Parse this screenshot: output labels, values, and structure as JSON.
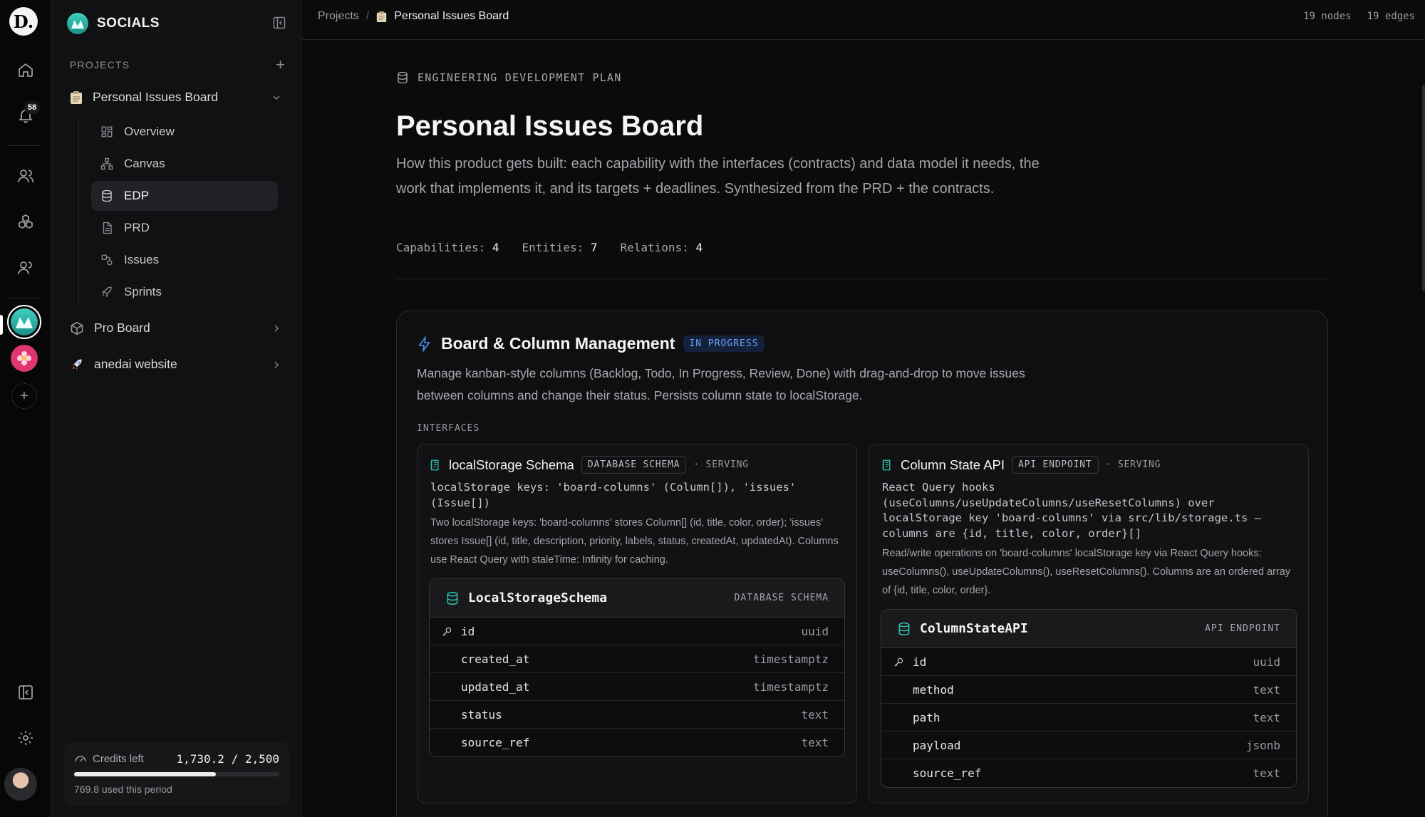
{
  "rail": {
    "logo_letter": "D.",
    "notification_count": "58"
  },
  "sidebar": {
    "workspace_name": "SOCIALS",
    "projects_label": "PROJECTS",
    "projects": [
      {
        "name": "Personal Issues Board",
        "icon": "clipboard-icon",
        "expanded": true
      },
      {
        "name": "Pro Board",
        "icon": "cube-icon",
        "expanded": false
      },
      {
        "name": "anedai website",
        "icon": "rocket-icon",
        "expanded": false
      }
    ],
    "subitems": [
      {
        "label": "Overview",
        "icon": "dashboard-icon"
      },
      {
        "label": "Canvas",
        "icon": "sitemap-icon"
      },
      {
        "label": "EDP",
        "icon": "database-icon",
        "active": true
      },
      {
        "label": "PRD",
        "icon": "document-icon"
      },
      {
        "label": "Issues",
        "icon": "issues-icon"
      },
      {
        "label": "Sprints",
        "icon": "rocket-icon"
      }
    ],
    "credits": {
      "label": "Credits left",
      "value": "1,730.2 / 2,500",
      "used": "769.8 used this period",
      "fraction_left": 0.692
    }
  },
  "topbar": {
    "breadcrumb_root": "Projects",
    "breadcrumb_sep": "/",
    "breadcrumb_current": "Personal Issues Board",
    "nodes": "19 nodes",
    "edges": "19 edges"
  },
  "page": {
    "eyebrow": "ENGINEERING DEVELOPMENT PLAN",
    "title": "Personal Issues Board",
    "description": "How this product gets built: each capability with the interfaces (contracts) and data model it needs, the work that implements it, and its targets + deadlines. Synthesized from the PRD + the contracts.",
    "metrics": [
      {
        "label": "Capabilities:",
        "value": "4"
      },
      {
        "label": "Entities:",
        "value": "7"
      },
      {
        "label": "Relations:",
        "value": "4"
      }
    ]
  },
  "capability": {
    "title": "Board & Column Management",
    "status": "IN PROGRESS",
    "status_color": "#6aa6ff",
    "description": "Manage kanban-style columns (Backlog, Todo, In Progress, Review, Done) with drag-and-drop to move issues between columns and change their status. Persists column state to localStorage.",
    "interfaces_label": "INTERFACES",
    "interfaces": [
      {
        "name": "localStorage Schema",
        "kind": "DATABASE SCHEMA",
        "state": "· SERVING",
        "code": "localStorage keys: 'board-columns' (Column[]), 'issues'\n(Issue[])",
        "note": "Two localStorage keys: 'board-columns' stores Column[] (id, title, color, order); 'issues' stores Issue[] (id, title, description, priority, labels, status, createdAt, updatedAt). Columns use React Query with staleTime: Infinity for caching.",
        "table": {
          "name": "LocalStorageSchema",
          "kind": "DATABASE SCHEMA",
          "fields": [
            {
              "name": "id",
              "type": "uuid",
              "key": true
            },
            {
              "name": "created_at",
              "type": "timestamptz"
            },
            {
              "name": "updated_at",
              "type": "timestamptz"
            },
            {
              "name": "status",
              "type": "text"
            },
            {
              "name": "source_ref",
              "type": "text"
            }
          ]
        }
      },
      {
        "name": "Column State API",
        "kind": "API ENDPOINT",
        "state": "· SERVING",
        "code": "React Query hooks\n(useColumns/useUpdateColumns/useResetColumns) over\nlocalStorage key 'board-columns' via src/lib/storage.ts —\ncolumns are {id, title, color, order}[]",
        "note": "Read/write operations on 'board-columns' localStorage key via React Query hooks: useColumns(), useUpdateColumns(), useResetColumns(). Columns are an ordered array of {id, title, color, order}.",
        "table": {
          "name": "ColumnStateAPI",
          "kind": "API ENDPOINT",
          "fields": [
            {
              "name": "id",
              "type": "uuid",
              "key": true
            },
            {
              "name": "method",
              "type": "text"
            },
            {
              "name": "path",
              "type": "text"
            },
            {
              "name": "payload",
              "type": "jsonb"
            },
            {
              "name": "source_ref",
              "type": "text"
            }
          ]
        }
      }
    ]
  }
}
